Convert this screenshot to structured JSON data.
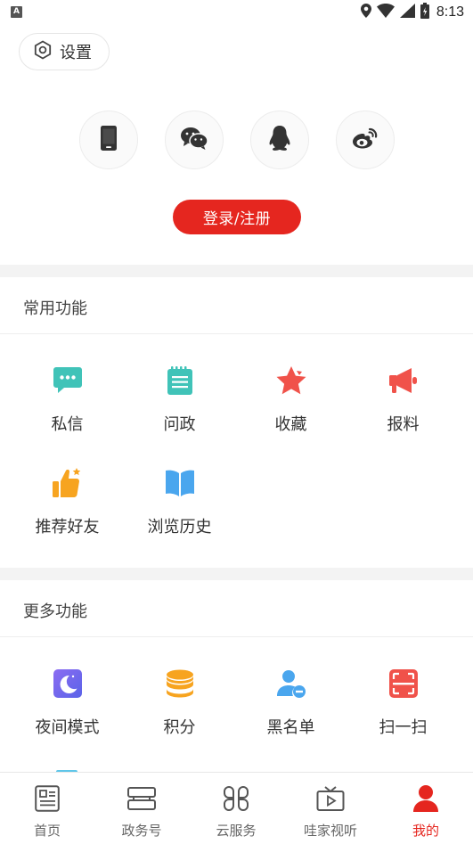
{
  "status_bar": {
    "time": "8:13",
    "notification_badge": "A"
  },
  "settings": {
    "label": "设置",
    "icon": "gear-icon"
  },
  "login": {
    "methods": [
      {
        "name": "phone",
        "icon": "phone-icon"
      },
      {
        "name": "wechat",
        "icon": "wechat-icon"
      },
      {
        "name": "qq",
        "icon": "qq-icon"
      },
      {
        "name": "weibo",
        "icon": "weibo-icon"
      }
    ],
    "button_label": "登录/注册"
  },
  "common_functions": {
    "title": "常用功能",
    "items": [
      {
        "label": "私信",
        "icon": "message-icon"
      },
      {
        "label": "问政",
        "icon": "notepad-icon"
      },
      {
        "label": "收藏",
        "icon": "star-icon"
      },
      {
        "label": "报料",
        "icon": "megaphone-icon"
      },
      {
        "label": "推荐好友",
        "icon": "thumbs-up-icon"
      },
      {
        "label": "浏览历史",
        "icon": "book-icon"
      }
    ]
  },
  "more_functions": {
    "title": "更多功能",
    "items": [
      {
        "label": "夜间模式",
        "icon": "moon-icon"
      },
      {
        "label": "积分",
        "icon": "coins-icon"
      },
      {
        "label": "黑名单",
        "icon": "blacklist-user-icon"
      },
      {
        "label": "扫一扫",
        "icon": "scan-icon"
      }
    ]
  },
  "tabbar": {
    "items": [
      {
        "label": "首页",
        "icon": "news-icon",
        "active": false
      },
      {
        "label": "政务号",
        "icon": "stack-icon",
        "active": false
      },
      {
        "label": "云服务",
        "icon": "grid-icon",
        "active": false
      },
      {
        "label": "哇家视听",
        "icon": "tv-icon",
        "active": false
      },
      {
        "label": "我的",
        "icon": "user-icon",
        "active": true
      }
    ]
  },
  "colors": {
    "accent": "#e5261f",
    "separator": "#f3f3f3"
  }
}
